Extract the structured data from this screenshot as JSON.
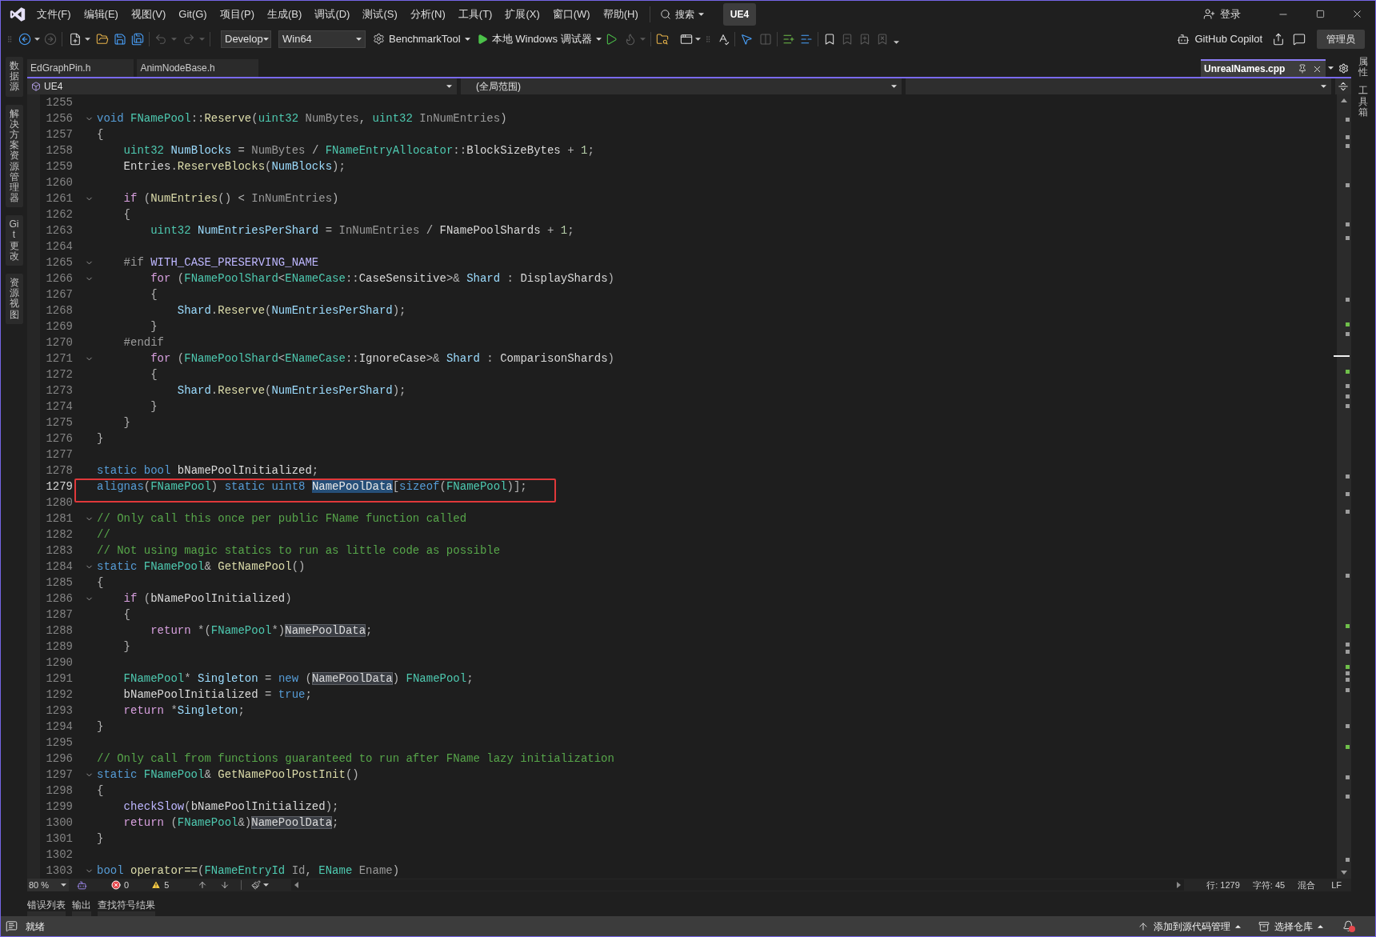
{
  "title_bar": {
    "menu": [
      "文件(F)",
      "编辑(E)",
      "视图(V)",
      "Git(G)",
      "项目(P)",
      "生成(B)",
      "调试(D)",
      "测试(S)",
      "分析(N)",
      "工具(T)",
      "扩展(X)",
      "窗口(W)",
      "帮助(H)"
    ],
    "search": "搜索",
    "solution": "UE4",
    "sign_in": "登录"
  },
  "toolbar": {
    "configuration": "Develop",
    "platform": "Win64",
    "startup_project": "BenchmarkTool",
    "debug_target": "本地 Windows 调试器",
    "copilot": "GitHub Copilot",
    "account": "管理员"
  },
  "left_tool_tabs": [
    "数据源",
    "解决方案资源管理器",
    "Git 更改",
    "资源视图"
  ],
  "right_tool_tabs": [
    "属性",
    "工具箱"
  ],
  "document_tabs": {
    "left": [
      {
        "label": "EdGraphPin.h",
        "selected": false
      },
      {
        "label": "AnimNodeBase.h",
        "selected": false
      }
    ],
    "right": [
      {
        "label": "UnrealNames.cpp",
        "selected": true
      }
    ]
  },
  "navigation_bar": {
    "project": "UE4",
    "scope": "(全局范围)"
  },
  "editor": {
    "lines": [
      {
        "number": "1255",
        "fold": false,
        "current": false
      },
      {
        "number": "1256",
        "fold": true,
        "current": false,
        "tokens": [
          {
            "text": "void ",
            "kind": "keyword"
          },
          {
            "text": "FNamePool",
            "kind": "type"
          },
          {
            "text": "::",
            "kind": "punctuation"
          },
          {
            "text": "Reserve",
            "kind": "function"
          },
          {
            "text": "(",
            "kind": "punctuation"
          },
          {
            "text": "uint32 ",
            "kind": "type"
          },
          {
            "text": "NumBytes",
            "kind": "parameter"
          },
          {
            "text": ", ",
            "kind": "punctuation"
          },
          {
            "text": "uint32 ",
            "kind": "type"
          },
          {
            "text": "InNumEntries",
            "kind": "parameter"
          },
          {
            "text": ")",
            "kind": "punctuation"
          }
        ]
      },
      {
        "number": "1257",
        "fold": false,
        "current": false,
        "tokens": [
          {
            "text": "{",
            "kind": "punctuation"
          }
        ]
      },
      {
        "number": "1258",
        "fold": false,
        "current": false,
        "tokens": [
          {
            "text": "    uint32 ",
            "kind": "type"
          },
          {
            "text": "NumBlocks",
            "kind": "local"
          },
          {
            "text": " = ",
            "kind": "punctuation"
          },
          {
            "text": "NumBytes",
            "kind": "parameter"
          },
          {
            "text": " / ",
            "kind": "punctuation"
          },
          {
            "text": "FNameEntryAllocator",
            "kind": "type"
          },
          {
            "text": "::",
            "kind": "punctuation"
          },
          {
            "text": "BlockSizeBytes",
            "kind": "plain"
          },
          {
            "text": " + ",
            "kind": "punctuation"
          },
          {
            "text": "1",
            "kind": "number"
          },
          {
            "text": ";",
            "kind": "punctuation"
          }
        ]
      },
      {
        "number": "1259",
        "fold": false,
        "current": false,
        "tokens": [
          {
            "text": "    Entries",
            "kind": "plain"
          },
          {
            "text": ".",
            "kind": "punctuation"
          },
          {
            "text": "ReserveBlocks",
            "kind": "function"
          },
          {
            "text": "(",
            "kind": "punctuation"
          },
          {
            "text": "NumBlocks",
            "kind": "local"
          },
          {
            "text": ");",
            "kind": "punctuation"
          }
        ]
      },
      {
        "number": "1260",
        "fold": false,
        "current": false
      },
      {
        "number": "1261",
        "fold": true,
        "current": false,
        "tokens": [
          {
            "text": "    if ",
            "kind": "control"
          },
          {
            "text": "(",
            "kind": "punctuation"
          },
          {
            "text": "NumEntries",
            "kind": "function"
          },
          {
            "text": "() < ",
            "kind": "punctuation"
          },
          {
            "text": "InNumEntries",
            "kind": "parameter"
          },
          {
            "text": ")",
            "kind": "punctuation"
          }
        ]
      },
      {
        "number": "1262",
        "fold": false,
        "current": false,
        "tokens": [
          {
            "text": "    {",
            "kind": "punctuation"
          }
        ]
      },
      {
        "number": "1263",
        "fold": false,
        "current": false,
        "tokens": [
          {
            "text": "        uint32 ",
            "kind": "type"
          },
          {
            "text": "NumEntriesPerShard",
            "kind": "local"
          },
          {
            "text": " = ",
            "kind": "punctuation"
          },
          {
            "text": "InNumEntries",
            "kind": "parameter"
          },
          {
            "text": " / ",
            "kind": "punctuation"
          },
          {
            "text": "FNamePoolShards",
            "kind": "plain"
          },
          {
            "text": " + ",
            "kind": "punctuation"
          },
          {
            "text": "1",
            "kind": "number"
          },
          {
            "text": ";",
            "kind": "punctuation"
          }
        ]
      },
      {
        "number": "1264",
        "fold": false,
        "current": false
      },
      {
        "number": "1265",
        "fold": true,
        "current": false,
        "tokens": [
          {
            "text": "    #if ",
            "kind": "preprocessor"
          },
          {
            "text": "WITH_CASE_PRESERVING_NAME",
            "kind": "macro"
          }
        ]
      },
      {
        "number": "1266",
        "fold": true,
        "current": false,
        "tokens": [
          {
            "text": "        for ",
            "kind": "control"
          },
          {
            "text": "(",
            "kind": "punctuation"
          },
          {
            "text": "FNamePoolShard",
            "kind": "type"
          },
          {
            "text": "<",
            "kind": "punctuation"
          },
          {
            "text": "ENameCase",
            "kind": "type"
          },
          {
            "text": "::",
            "kind": "punctuation"
          },
          {
            "text": "CaseSensitive",
            "kind": "plain"
          },
          {
            "text": ">& ",
            "kind": "punctuation"
          },
          {
            "text": "Shard",
            "kind": "local"
          },
          {
            "text": " : ",
            "kind": "punctuation"
          },
          {
            "text": "DisplayShards",
            "kind": "plain"
          },
          {
            "text": ")",
            "kind": "punctuation"
          }
        ]
      },
      {
        "number": "1267",
        "fold": false,
        "current": false,
        "tokens": [
          {
            "text": "        {",
            "kind": "punctuation"
          }
        ]
      },
      {
        "number": "1268",
        "fold": false,
        "current": false,
        "tokens": [
          {
            "text": "            Shard",
            "kind": "local"
          },
          {
            "text": ".",
            "kind": "punctuation"
          },
          {
            "text": "Reserve",
            "kind": "function"
          },
          {
            "text": "(",
            "kind": "punctuation"
          },
          {
            "text": "NumEntriesPerShard",
            "kind": "local"
          },
          {
            "text": ");",
            "kind": "punctuation"
          }
        ]
      },
      {
        "number": "1269",
        "fold": false,
        "current": false,
        "tokens": [
          {
            "text": "        }",
            "kind": "punctuation"
          }
        ]
      },
      {
        "number": "1270",
        "fold": false,
        "current": false,
        "tokens": [
          {
            "text": "    #endif",
            "kind": "preprocessor"
          }
        ]
      },
      {
        "number": "1271",
        "fold": true,
        "current": false,
        "tokens": [
          {
            "text": "        for ",
            "kind": "control"
          },
          {
            "text": "(",
            "kind": "punctuation"
          },
          {
            "text": "FNamePoolShard",
            "kind": "type"
          },
          {
            "text": "<",
            "kind": "punctuation"
          },
          {
            "text": "ENameCase",
            "kind": "type"
          },
          {
            "text": "::",
            "kind": "punctuation"
          },
          {
            "text": "IgnoreCase",
            "kind": "plain"
          },
          {
            "text": ">& ",
            "kind": "punctuation"
          },
          {
            "text": "Shard",
            "kind": "local"
          },
          {
            "text": " : ",
            "kind": "punctuation"
          },
          {
            "text": "ComparisonShards",
            "kind": "plain"
          },
          {
            "text": ")",
            "kind": "punctuation"
          }
        ]
      },
      {
        "number": "1272",
        "fold": false,
        "current": false,
        "tokens": [
          {
            "text": "        {",
            "kind": "punctuation"
          }
        ]
      },
      {
        "number": "1273",
        "fold": false,
        "current": false,
        "tokens": [
          {
            "text": "            Shard",
            "kind": "local"
          },
          {
            "text": ".",
            "kind": "punctuation"
          },
          {
            "text": "Reserve",
            "kind": "function"
          },
          {
            "text": "(",
            "kind": "punctuation"
          },
          {
            "text": "NumEntriesPerShard",
            "kind": "local"
          },
          {
            "text": ");",
            "kind": "punctuation"
          }
        ]
      },
      {
        "number": "1274",
        "fold": false,
        "current": false,
        "tokens": [
          {
            "text": "        }",
            "kind": "punctuation"
          }
        ]
      },
      {
        "number": "1275",
        "fold": false,
        "current": false,
        "tokens": [
          {
            "text": "    }",
            "kind": "punctuation"
          }
        ]
      },
      {
        "number": "1276",
        "fold": false,
        "current": false,
        "tokens": [
          {
            "text": "}",
            "kind": "punctuation"
          }
        ]
      },
      {
        "number": "1277",
        "fold": false,
        "current": false
      },
      {
        "number": "1278",
        "fold": false,
        "current": false,
        "tokens": [
          {
            "text": "static bool ",
            "kind": "keyword"
          },
          {
            "text": "bNamePoolInitialized",
            "kind": "plain"
          },
          {
            "text": ";",
            "kind": "punctuation"
          }
        ]
      },
      {
        "number": "1279",
        "fold": false,
        "current": true,
        "tokens": [
          {
            "text": "alignas",
            "kind": "keyword"
          },
          {
            "text": "(",
            "kind": "punctuation"
          },
          {
            "text": "FNamePool",
            "kind": "type"
          },
          {
            "text": ") ",
            "kind": "punctuation"
          },
          {
            "text": "static uint8 ",
            "kind": "keyword"
          },
          {
            "text": "NamePoolData",
            "kind": "selection"
          },
          {
            "text": "[",
            "kind": "punctuation"
          },
          {
            "text": "sizeof",
            "kind": "keyword"
          },
          {
            "text": "(",
            "kind": "punctuation"
          },
          {
            "text": "FNamePool",
            "kind": "type"
          },
          {
            "text": ")];",
            "kind": "punctuation"
          }
        ]
      },
      {
        "number": "1280",
        "fold": false,
        "current": false
      },
      {
        "number": "1281",
        "fold": true,
        "current": false,
        "tokens": [
          {
            "text": "// Only call this once per public FName function called",
            "kind": "comment"
          }
        ]
      },
      {
        "number": "1282",
        "fold": false,
        "current": false,
        "tokens": [
          {
            "text": "//",
            "kind": "comment"
          }
        ]
      },
      {
        "number": "1283",
        "fold": false,
        "current": false,
        "tokens": [
          {
            "text": "// Not using magic statics to run as little code as possible",
            "kind": "comment"
          }
        ]
      },
      {
        "number": "1284",
        "fold": true,
        "current": false,
        "tokens": [
          {
            "text": "static ",
            "kind": "keyword"
          },
          {
            "text": "FNamePool",
            "kind": "type"
          },
          {
            "text": "& ",
            "kind": "punctuation"
          },
          {
            "text": "GetNamePool",
            "kind": "function"
          },
          {
            "text": "()",
            "kind": "punctuation"
          }
        ]
      },
      {
        "number": "1285",
        "fold": false,
        "current": false,
        "tokens": [
          {
            "text": "{",
            "kind": "punctuation"
          }
        ]
      },
      {
        "number": "1286",
        "fold": true,
        "current": false,
        "tokens": [
          {
            "text": "    if ",
            "kind": "control"
          },
          {
            "text": "(",
            "kind": "punctuation"
          },
          {
            "text": "bNamePoolInitialized",
            "kind": "plain"
          },
          {
            "text": ")",
            "kind": "punctuation"
          }
        ]
      },
      {
        "number": "1287",
        "fold": false,
        "current": false,
        "tokens": [
          {
            "text": "    {",
            "kind": "punctuation"
          }
        ]
      },
      {
        "number": "1288",
        "fold": false,
        "current": false,
        "tokens": [
          {
            "text": "        return ",
            "kind": "control"
          },
          {
            "text": "*(",
            "kind": "punctuation"
          },
          {
            "text": "FNamePool",
            "kind": "type"
          },
          {
            "text": "*)",
            "kind": "punctuation"
          },
          {
            "text": "NamePoolData",
            "kind": "reference"
          },
          {
            "text": ";",
            "kind": "punctuation"
          }
        ]
      },
      {
        "number": "1289",
        "fold": false,
        "current": false,
        "tokens": [
          {
            "text": "    }",
            "kind": "punctuation"
          }
        ]
      },
      {
        "number": "1290",
        "fold": false,
        "current": false
      },
      {
        "number": "1291",
        "fold": false,
        "current": false,
        "tokens": [
          {
            "text": "    FNamePool",
            "kind": "type"
          },
          {
            "text": "* ",
            "kind": "punctuation"
          },
          {
            "text": "Singleton",
            "kind": "local"
          },
          {
            "text": " = ",
            "kind": "punctuation"
          },
          {
            "text": "new ",
            "kind": "keyword"
          },
          {
            "text": "(",
            "kind": "punctuation"
          },
          {
            "text": "NamePoolData",
            "kind": "reference"
          },
          {
            "text": ") ",
            "kind": "punctuation"
          },
          {
            "text": "FNamePool",
            "kind": "type"
          },
          {
            "text": ";",
            "kind": "punctuation"
          }
        ]
      },
      {
        "number": "1292",
        "fold": false,
        "current": false,
        "tokens": [
          {
            "text": "    bNamePoolInitialized",
            "kind": "plain"
          },
          {
            "text": " = ",
            "kind": "punctuation"
          },
          {
            "text": "true",
            "kind": "keyword"
          },
          {
            "text": ";",
            "kind": "punctuation"
          }
        ]
      },
      {
        "number": "1293",
        "fold": false,
        "current": false,
        "tokens": [
          {
            "text": "    return ",
            "kind": "control"
          },
          {
            "text": "*",
            "kind": "punctuation"
          },
          {
            "text": "Singleton",
            "kind": "local"
          },
          {
            "text": ";",
            "kind": "punctuation"
          }
        ]
      },
      {
        "number": "1294",
        "fold": false,
        "current": false,
        "tokens": [
          {
            "text": "}",
            "kind": "punctuation"
          }
        ]
      },
      {
        "number": "1295",
        "fold": false,
        "current": false
      },
      {
        "number": "1296",
        "fold": false,
        "current": false,
        "tokens": [
          {
            "text": "// Only call from functions guaranteed to run after FName lazy initialization",
            "kind": "comment"
          }
        ]
      },
      {
        "number": "1297",
        "fold": true,
        "current": false,
        "tokens": [
          {
            "text": "static ",
            "kind": "keyword"
          },
          {
            "text": "FNamePool",
            "kind": "type"
          },
          {
            "text": "& ",
            "kind": "punctuation"
          },
          {
            "text": "GetNamePoolPostInit",
            "kind": "function"
          },
          {
            "text": "()",
            "kind": "punctuation"
          }
        ]
      },
      {
        "number": "1298",
        "fold": false,
        "current": false,
        "tokens": [
          {
            "text": "{",
            "kind": "punctuation"
          }
        ]
      },
      {
        "number": "1299",
        "fold": false,
        "current": false,
        "tokens": [
          {
            "text": "    checkSlow",
            "kind": "macro"
          },
          {
            "text": "(",
            "kind": "punctuation"
          },
          {
            "text": "bNamePoolInitialized",
            "kind": "plain"
          },
          {
            "text": ");",
            "kind": "punctuation"
          }
        ]
      },
      {
        "number": "1300",
        "fold": false,
        "current": false,
        "tokens": [
          {
            "text": "    return ",
            "kind": "control"
          },
          {
            "text": "(",
            "kind": "punctuation"
          },
          {
            "text": "FNamePool",
            "kind": "type"
          },
          {
            "text": "&)",
            "kind": "punctuation"
          },
          {
            "text": "NamePoolData",
            "kind": "reference"
          },
          {
            "text": ";",
            "kind": "punctuation"
          }
        ]
      },
      {
        "number": "1301",
        "fold": false,
        "current": false,
        "tokens": [
          {
            "text": "}",
            "kind": "punctuation"
          }
        ]
      },
      {
        "number": "1302",
        "fold": false,
        "current": false
      },
      {
        "number": "1303",
        "fold": true,
        "current": false,
        "tokens": [
          {
            "text": "bool ",
            "kind": "keyword"
          },
          {
            "text": "operator==",
            "kind": "function"
          },
          {
            "text": "(",
            "kind": "punctuation"
          },
          {
            "text": "FNameEntryId ",
            "kind": "type"
          },
          {
            "text": "Id",
            "kind": "parameter"
          },
          {
            "text": ", ",
            "kind": "punctuation"
          },
          {
            "text": "EName ",
            "kind": "type"
          },
          {
            "text": "Ename",
            "kind": "parameter"
          },
          {
            "text": ")",
            "kind": "punctuation"
          }
        ]
      }
    ]
  },
  "editor_status": {
    "zoom": "80 %",
    "errors": "0",
    "warnings": "5",
    "line": "行: 1279",
    "column": "字符: 45",
    "encoding": "混合",
    "line_ending": "LF"
  },
  "output_tabs": [
    "错误列表",
    "输出",
    "查找符号结果"
  ],
  "status_bar": {
    "state": "就绪",
    "source_control": "添加到源代码管理",
    "repository": "选择仓库"
  }
}
